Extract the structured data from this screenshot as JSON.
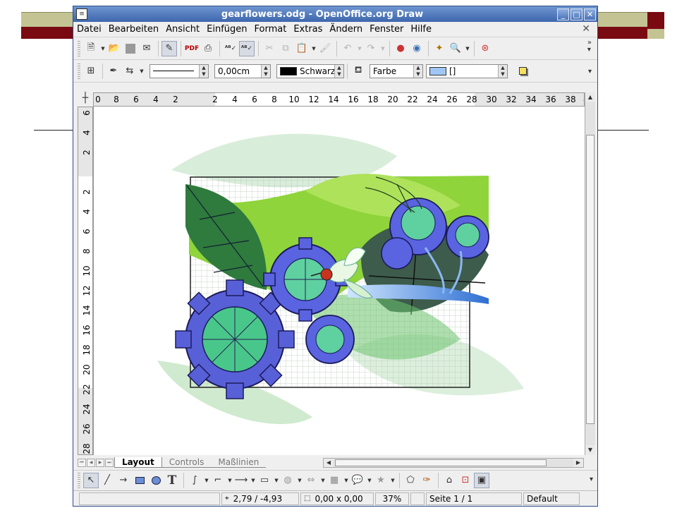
{
  "window": {
    "title": "gearflowers.odg - OpenOffice.org Draw"
  },
  "menu": [
    "Datei",
    "Bearbeiten",
    "Ansicht",
    "Einfügen",
    "Format",
    "Extras",
    "Ändern",
    "Fenster",
    "Hilfe"
  ],
  "line_area": {
    "line_width": "0,00cm",
    "line_color": "Schwarz",
    "area_style": "Farbe",
    "area_color": "[]"
  },
  "hruler_ticks": [
    "0",
    "8",
    "6",
    "4",
    "2",
    "2",
    "4",
    "6",
    "8",
    "10",
    "12",
    "14",
    "16",
    "18",
    "20",
    "22",
    "24",
    "26",
    "28",
    "30",
    "32",
    "34",
    "36",
    "38",
    "4"
  ],
  "vruler_ticks": [
    "6",
    "4",
    "2",
    "2",
    "4",
    "6",
    "8",
    "10",
    "12",
    "14",
    "16",
    "18",
    "20",
    "22",
    "24",
    "26",
    "28"
  ],
  "tabs": [
    {
      "label": "Layout",
      "active": true
    },
    {
      "label": "Controls",
      "active": false
    },
    {
      "label": "Maßlinien",
      "active": false
    }
  ],
  "status": {
    "position": "2,79 / -4,93",
    "size": "0,00 x 0,00",
    "zoom": "37%",
    "page": "Seite 1 / 1",
    "master": "Default"
  },
  "colors": {
    "title_bar": "#4a72b8",
    "slide_bar_khaki": "#c3c394",
    "slide_bar_maroon": "#7a0a12",
    "leaf_green": "#8fd43a",
    "gear_blue": "#5860d8"
  }
}
